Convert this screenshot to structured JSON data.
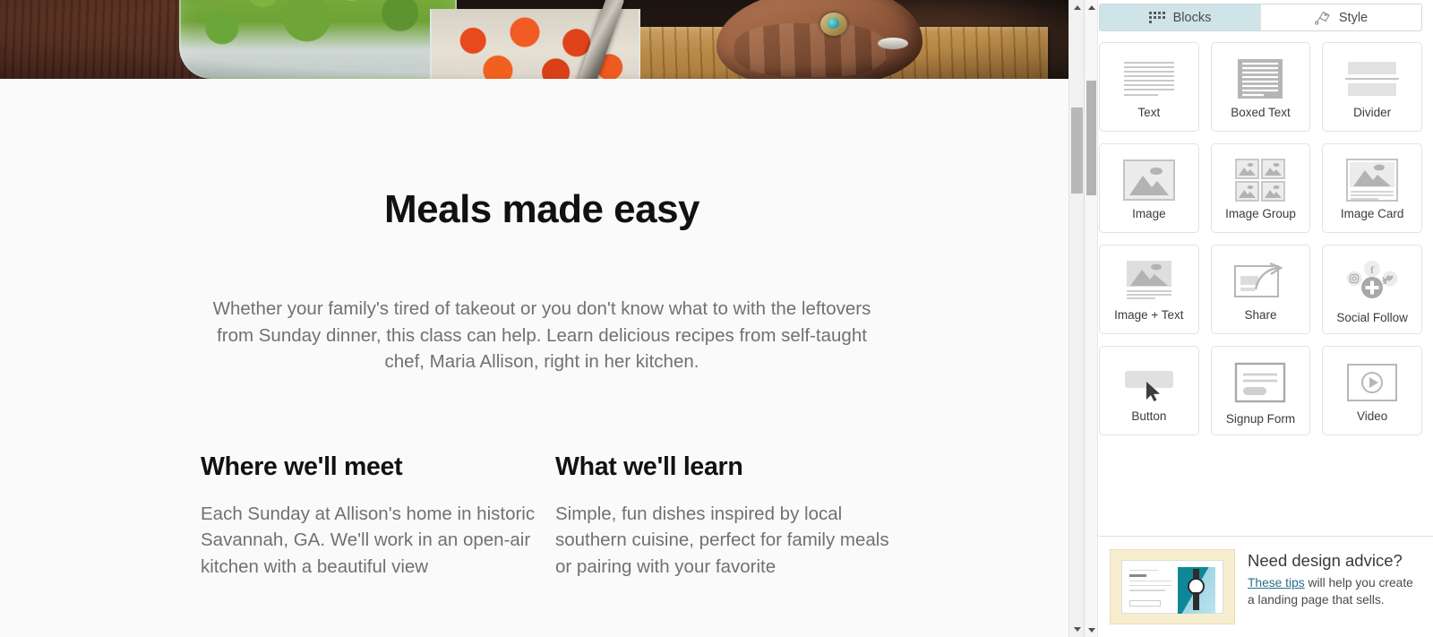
{
  "canvas": {
    "hero": {
      "alt": "kitchen-photo-greens-tomatoes-knife-hands"
    },
    "headline": "Meals made easy",
    "lede": "Whether your family's tired of takeout or you don't know what to with the leftovers from Sunday dinner, this class can help. Learn delicious recipes from self-taught chef, Maria Allison, right in her kitchen.",
    "columns": [
      {
        "heading": "Where we'll meet",
        "body": "Each Sunday at Allison's home in historic Savannah, GA. We'll work in an open-air kitchen with a beautiful view"
      },
      {
        "heading": "What we'll learn",
        "body": "Simple, fun dishes inspired by local southern cuisine, perfect for family meals or pairing with your favorite"
      }
    ]
  },
  "panel": {
    "tabs": [
      {
        "label": "Blocks",
        "icon": "grid-dots-icon",
        "active": true
      },
      {
        "label": "Style",
        "icon": "paint-tag-icon",
        "active": false
      }
    ],
    "blocks": [
      {
        "label": "Text",
        "icon": "text-lines-icon"
      },
      {
        "label": "Boxed Text",
        "icon": "boxed-text-icon"
      },
      {
        "label": "Divider",
        "icon": "divider-icon"
      },
      {
        "label": "Image",
        "icon": "image-icon"
      },
      {
        "label": "Image Group",
        "icon": "image-group-icon"
      },
      {
        "label": "Image Card",
        "icon": "image-card-icon"
      },
      {
        "label": "Image + Text",
        "icon": "image-text-icon"
      },
      {
        "label": "Share",
        "icon": "share-arrow-icon"
      },
      {
        "label": "Social Follow",
        "icon": "social-follow-icon"
      },
      {
        "label": "Button",
        "icon": "button-cursor-icon"
      },
      {
        "label": "Signup Form",
        "icon": "signup-form-icon"
      },
      {
        "label": "Video",
        "icon": "video-play-icon"
      }
    ],
    "advice": {
      "title": "Need design advice?",
      "link_text": "These tips",
      "body_after_link": " will help you create a landing page that sells.",
      "thumb_alt": "landing-page-example-thumbnail"
    }
  },
  "colors": {
    "tab_active_bg": "#cfe4e9",
    "tab_active_border": "#8fbcc6",
    "link": "#2a6f8a",
    "advice_thumb_bg": "#f7edcf",
    "body_text": "#6f7271",
    "heading_text": "#111111"
  }
}
